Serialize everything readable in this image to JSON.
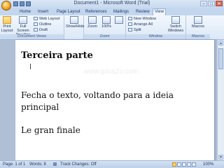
{
  "window": {
    "title": "Document1 - Microsoft Word (Trial)",
    "controls": [
      "–",
      "□",
      "✕"
    ]
  },
  "tabs": [
    "Home",
    "Insert",
    "Page Layout",
    "References",
    "Mailings",
    "Review",
    "View"
  ],
  "active_tab": "View",
  "ribbon": {
    "document_views": {
      "label": "Document Views",
      "print_layout": "Print Layout",
      "full_screen_reading": "Full Screen Reading",
      "web_layout": "Web Layout",
      "outline": "Outline",
      "draft": "Draft"
    },
    "show_hide": {
      "label": "Show/Hide"
    },
    "zoom": {
      "label": "Zoom",
      "zoom_button": "Zoom",
      "hundred_percent": "100%"
    },
    "window": {
      "label": "Window",
      "new_window": "New Window",
      "arrange_all": "Arrange All",
      "split": "Split",
      "switch_windows": "Switch Windows"
    },
    "macros": {
      "label": "Macros",
      "macros_button": "Macros"
    }
  },
  "document": {
    "heading": "Terceira parte",
    "cursor": "I",
    "watermark": "www.jpivaZu.com",
    "paragraph1": "Fecha o texto, voltando para a ideia principal",
    "paragraph2": "Le gran finale"
  },
  "status_bar": {
    "page": "Page: 1 of 1",
    "words": "Words: 8",
    "track_changes": "Track Changes: Off",
    "zoom": "100%"
  },
  "colors": {
    "ribbon_bg": "#dbe8f7",
    "workspace_bg": "#aebfd6",
    "active_view_highlight": "#ffc75a"
  }
}
